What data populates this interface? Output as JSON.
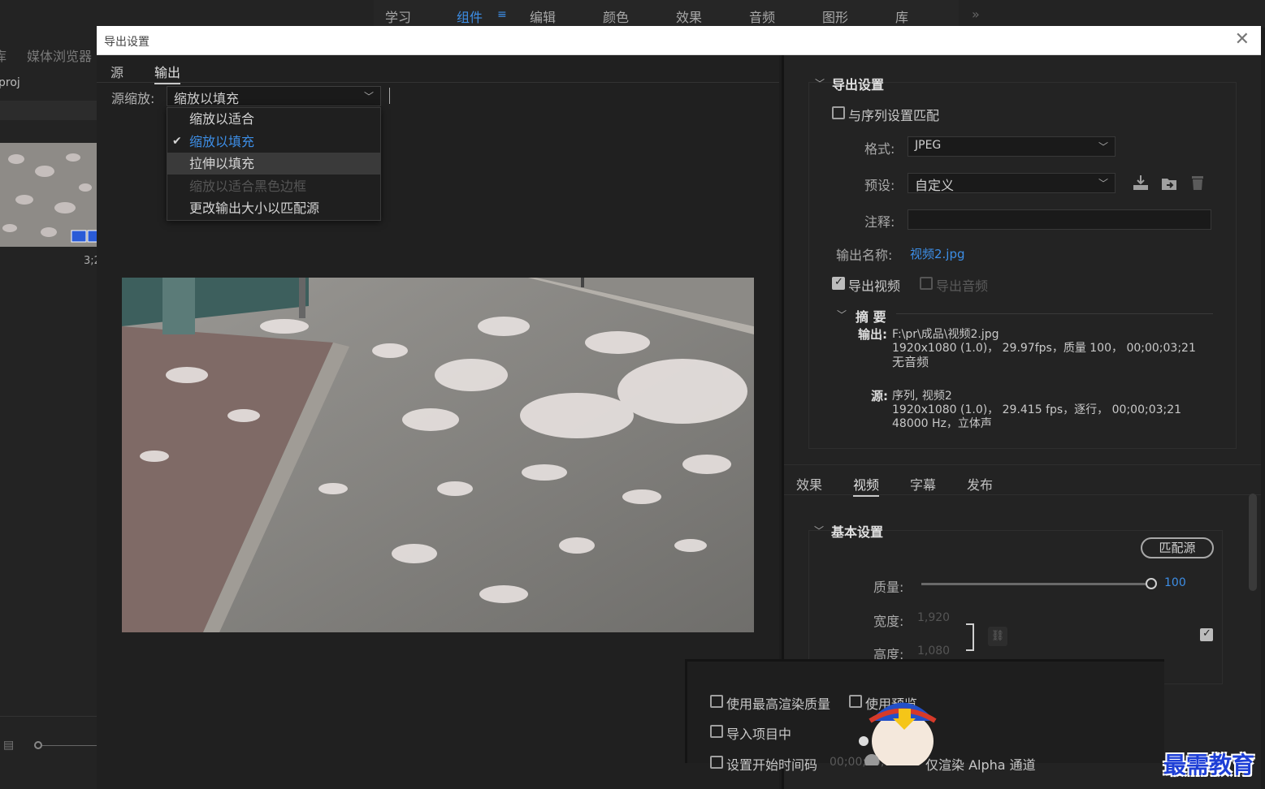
{
  "workspace_tabs": [
    "学习",
    "组件",
    "编辑",
    "颜色",
    "效果",
    "音频",
    "图形",
    "库"
  ],
  "workspace_active": "组件",
  "workspace_more": "»",
  "bg_panel": {
    "tab1": "库",
    "tab2": "媒体浏览器",
    "proj": "proj",
    "timecode": "3;2"
  },
  "dialog": {
    "title": "导出设置",
    "close": "✕",
    "tabs": {
      "source": "源",
      "output": "输出"
    },
    "source_scale_label": "源缩放:",
    "source_scale_value": "缩放以填充",
    "menu": {
      "items": [
        "缩放以适合",
        "缩放以填充",
        "拉伸以填充",
        "缩放以适合黑色边框",
        "更改输出大小以匹配源"
      ],
      "selected": "缩放以填充",
      "hovered": "拉伸以填充",
      "disabled": "缩放以适合黑色边框"
    }
  },
  "export_settings": {
    "section_title": "导出设置",
    "match_sequence": "与序列设置匹配",
    "format_label": "格式:",
    "format_value": "JPEG",
    "preset_label": "预设:",
    "preset_value": "自定义",
    "comments_label": "注释:",
    "comments_value": "",
    "output_name_label": "输出名称:",
    "output_name_value": "视频2.jpg",
    "export_video": "导出视频",
    "export_audio": "导出音频",
    "summary_title": "摘 要",
    "output_label": "输出:",
    "output_line1": "F:\\pr\\成品\\视频2.jpg",
    "output_line2": "1920x1080 (1.0)， 29.97fps，质量 100， 00;00;03;21",
    "output_line3": "无音频",
    "source_label": "源:",
    "source_line1": "序列, 视频2",
    "source_line2": "1920x1080 (1.0)， 29.415 fps，逐行， 00;00;03;21",
    "source_line3": "48000 Hz，立体声"
  },
  "lower_tabs": [
    "效果",
    "视频",
    "字幕",
    "发布"
  ],
  "lower_tab_active": "视频",
  "basic_settings": {
    "title": "基本设置",
    "match_source": "匹配源",
    "quality_label": "质量:",
    "quality_value": "100",
    "width_label": "宽度:",
    "width_value": "1,920",
    "height_label": "高度:",
    "height_value": "1,080"
  },
  "bottom": {
    "max_render": "使用最高渲染质量",
    "use_preview": "使用预览",
    "import_project": "导入项目中",
    "set_timecode": "设置开始时间码",
    "timecode_value": "00;00;00;00",
    "alpha_only": "仅渲染 Alpha 通道"
  },
  "watermark": "最需教育",
  "colors": {
    "accent": "#3d8ee6",
    "panel": "#232323",
    "dialog_bg": "#1d1d1d"
  }
}
